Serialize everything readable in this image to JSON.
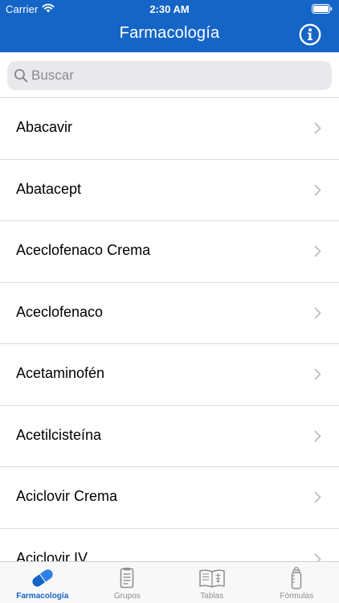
{
  "status_bar": {
    "carrier": "Carrier",
    "time": "2:30 AM"
  },
  "nav": {
    "title": "Farmacología",
    "info_icon": "info-icon"
  },
  "search": {
    "placeholder": "Buscar",
    "value": ""
  },
  "list": {
    "items": [
      {
        "label": "Abacavir"
      },
      {
        "label": "Abatacept"
      },
      {
        "label": "Aceclofenaco Crema"
      },
      {
        "label": "Aceclofenaco"
      },
      {
        "label": "Acetaminofén"
      },
      {
        "label": "Acetilcisteína"
      },
      {
        "label": "Aciclovir Crema"
      },
      {
        "label": "Aciclovir IV"
      }
    ]
  },
  "tabs": [
    {
      "label": "Farmacología",
      "icon": "capsule-icon",
      "active": true
    },
    {
      "label": "Grupos",
      "icon": "clipboard-icon",
      "active": false
    },
    {
      "label": "Tablas",
      "icon": "book-icon",
      "active": false
    },
    {
      "label": "Fórmulas",
      "icon": "baby-bottle-icon",
      "active": false
    }
  ],
  "colors": {
    "accent": "#1565c7",
    "tab_inactive": "#8e8e93"
  }
}
